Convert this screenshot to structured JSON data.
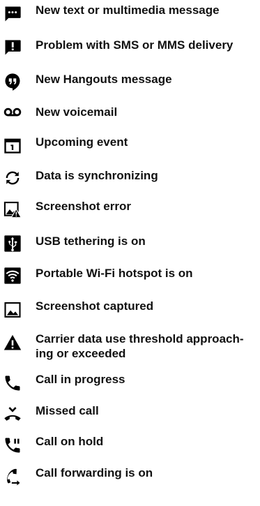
{
  "items": [
    {
      "icon": "message-icon",
      "label": "New text or multimedia message"
    },
    {
      "icon": "message-alert-icon",
      "label": "Problem with SMS or MMS delivery"
    },
    {
      "icon": "hangouts-icon",
      "label": "New Hangouts message"
    },
    {
      "icon": "voicemail-icon",
      "label": "New voicemail"
    },
    {
      "icon": "calendar-icon",
      "label": "Upcoming event"
    },
    {
      "icon": "sync-icon",
      "label": "Data is synchronizing"
    },
    {
      "icon": "screenshot-error-icon",
      "label": "Screenshot error"
    },
    {
      "icon": "usb-icon",
      "label": "USB tethering is on"
    },
    {
      "icon": "wifi-hotspot-icon",
      "label": "Portable Wi-Fi hotspot is on"
    },
    {
      "icon": "screenshot-icon",
      "label": "Screenshot captured"
    },
    {
      "icon": "warning-icon",
      "label": "Carrier data use threshold approach-ing or exceeded"
    },
    {
      "icon": "call-icon",
      "label": "Call in progress"
    },
    {
      "icon": "missed-call-icon",
      "label": "Missed call"
    },
    {
      "icon": "call-hold-icon",
      "label": "Call on hold"
    },
    {
      "icon": "call-forward-icon",
      "label": "Call forwarding is on"
    }
  ]
}
